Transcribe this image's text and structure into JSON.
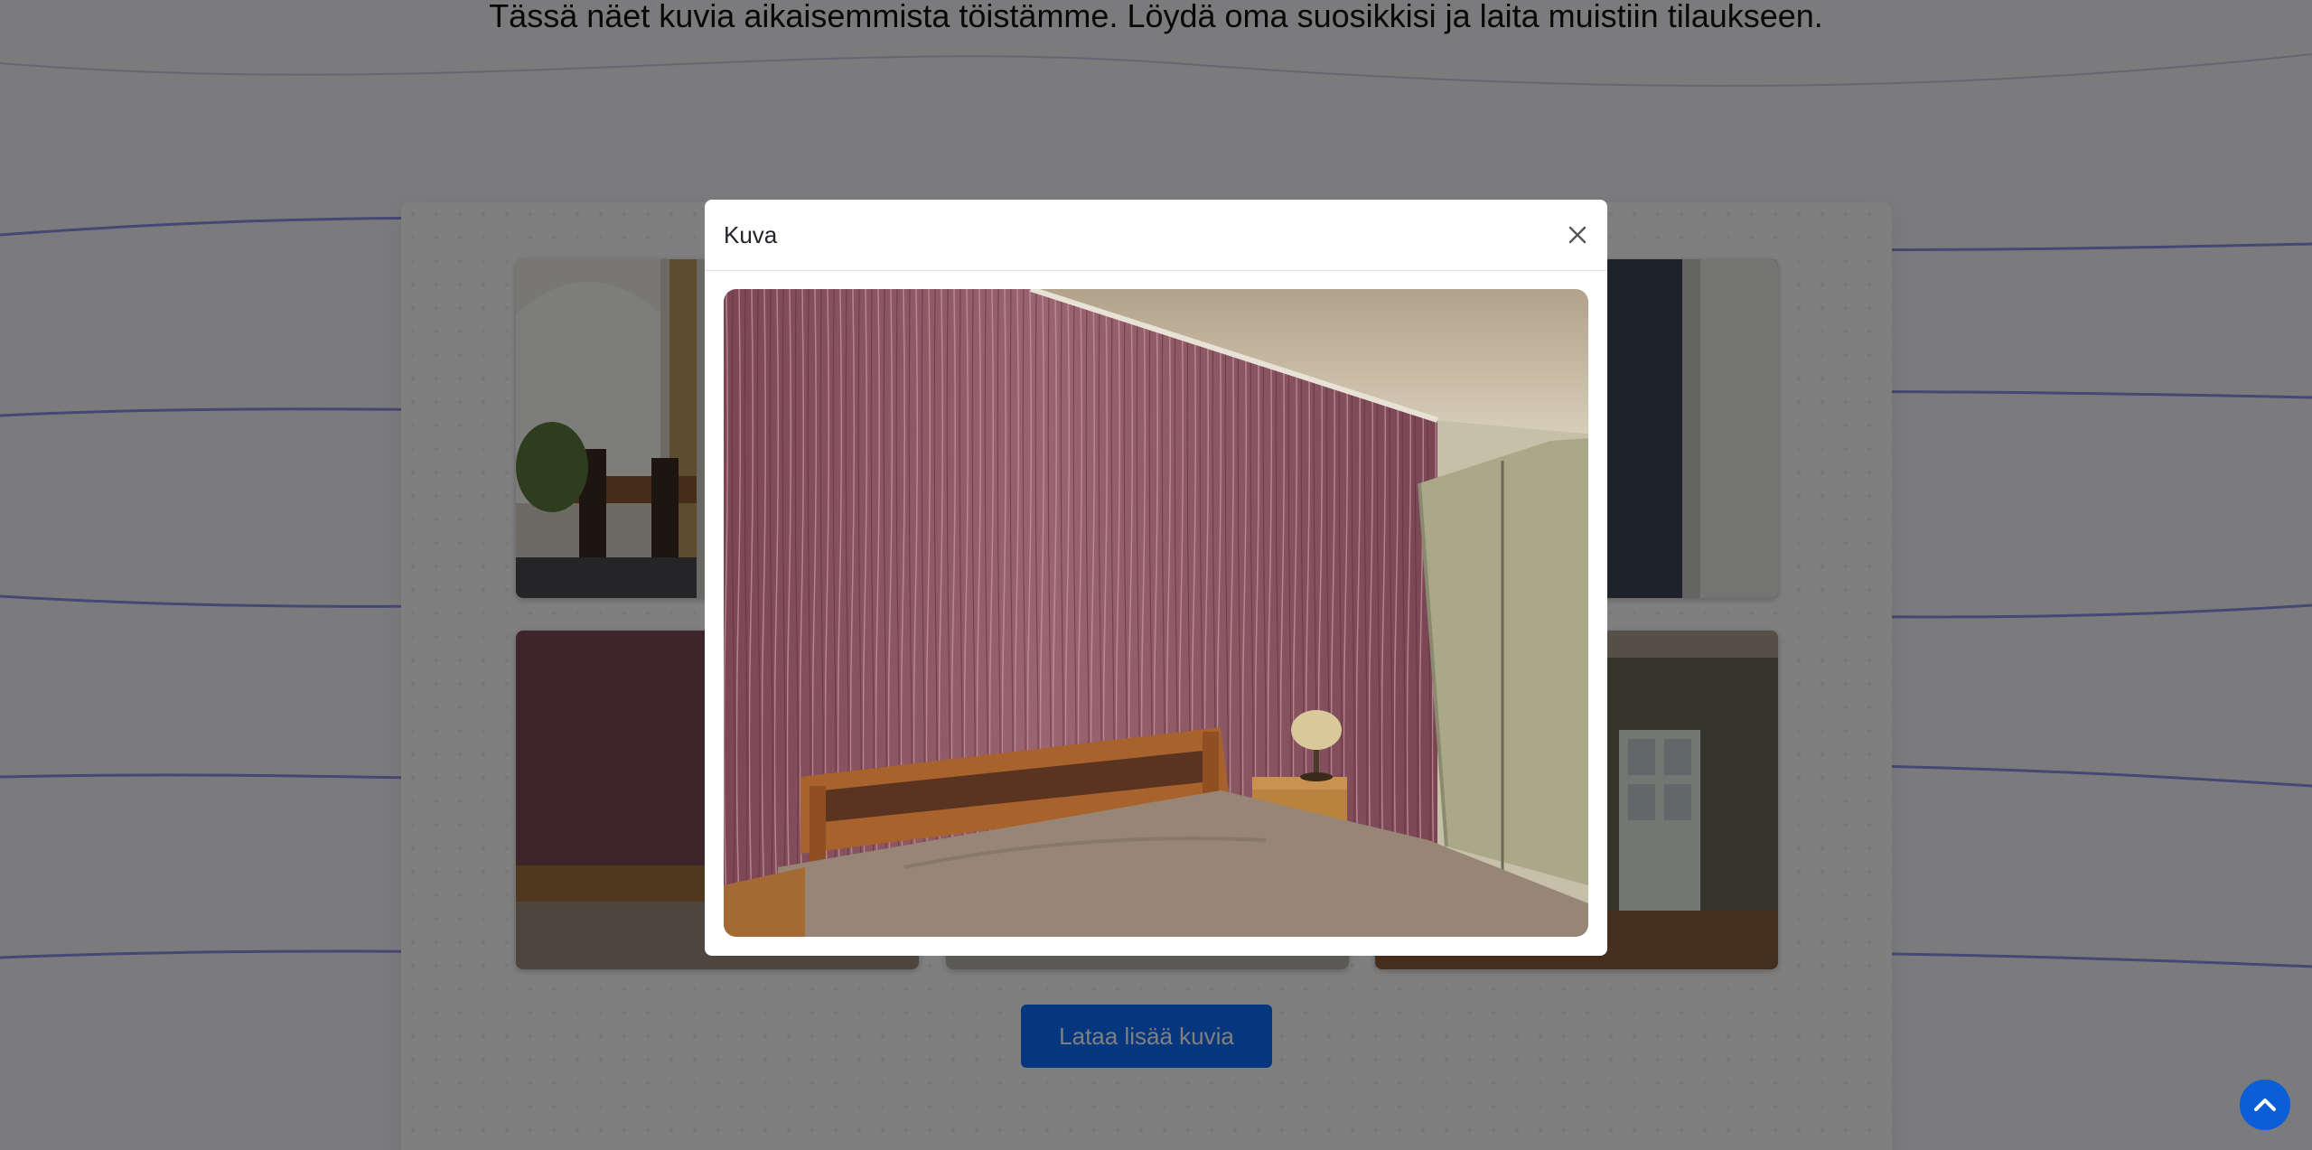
{
  "page": {
    "intro_text": "Tässä näet kuvia aikaisemmista töistämme. Löydä oma suosikkisi ja laita muistiin tilaukseen."
  },
  "gallery": {
    "load_more_label": "Lataa lisää kuvia"
  },
  "modal": {
    "title": "Kuva",
    "close_icon": "close-icon"
  },
  "scroll_top": {
    "icon": "chevron-up-icon"
  },
  "colors": {
    "primary": "#0d6efd",
    "overlay": "rgba(0,0,0,0.5)",
    "wallpaper_purple": "#8a4d5c"
  }
}
